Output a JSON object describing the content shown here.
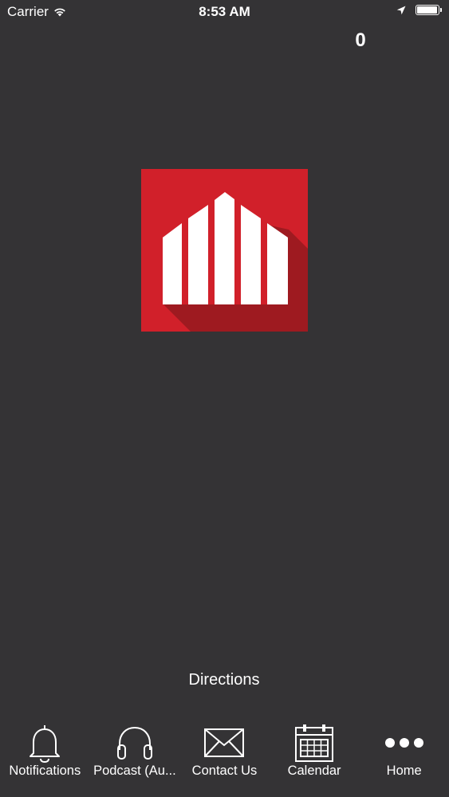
{
  "status_bar": {
    "carrier": "Carrier",
    "time": "8:53 AM",
    "battery_level": 1.0
  },
  "header": {
    "counter": "0"
  },
  "logo": {
    "icon": "building-logo-icon",
    "colors": {
      "background": "#d1202a",
      "shadow": "#9e1a20",
      "bars": "#ffffff"
    }
  },
  "main": {
    "directions_label": "Directions"
  },
  "tab_bar": {
    "tabs": [
      {
        "label": "Notifications",
        "icon": "bell-icon"
      },
      {
        "label": "Podcast (Au...",
        "icon": "headphones-icon"
      },
      {
        "label": "Contact Us",
        "icon": "envelope-icon"
      },
      {
        "label": "Calendar",
        "icon": "calendar-icon"
      },
      {
        "label": "Home",
        "icon": "more-dots-icon"
      }
    ]
  },
  "colors": {
    "background": "#343335",
    "text": "#ffffff"
  }
}
